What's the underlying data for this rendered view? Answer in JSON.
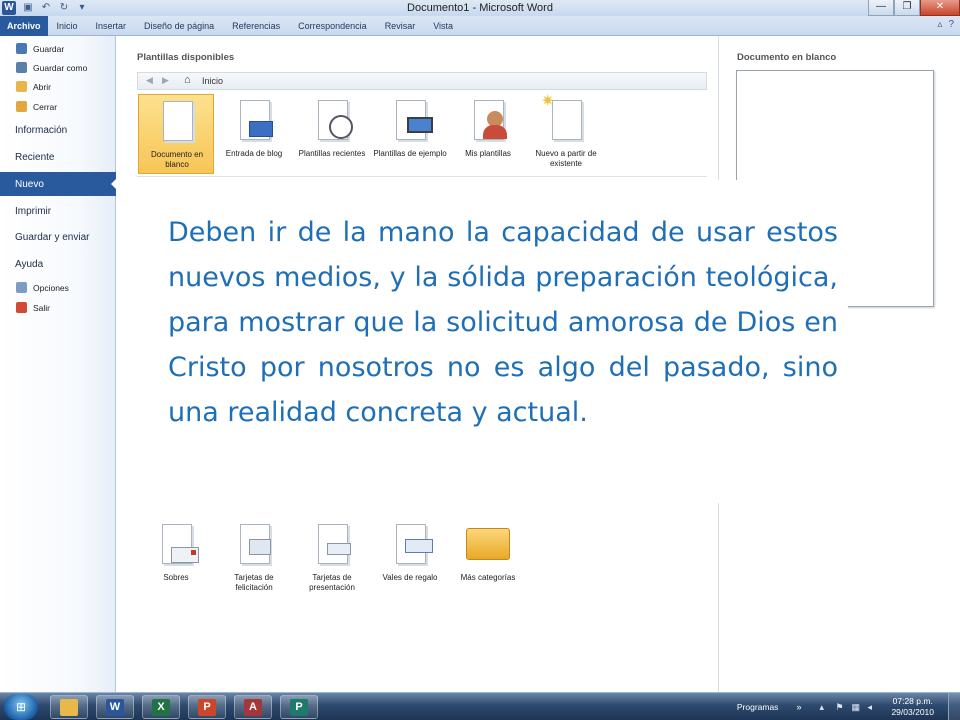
{
  "window": {
    "title": "Documento1 - Microsoft Word",
    "controls": [
      "—",
      "❐",
      "✕"
    ]
  },
  "ribbon": {
    "tabs": [
      "Archivo",
      "Inicio",
      "Insertar",
      "Diseño de página",
      "Referencias",
      "Correspondencia",
      "Revisar",
      "Vista"
    ]
  },
  "sidenav": {
    "save": "Guardar",
    "save_as": "Guardar como",
    "open": "Abrir",
    "close": "Cerrar",
    "info": "Información",
    "recent": "Reciente",
    "new": "Nuevo",
    "print": "Imprimir",
    "save_send": "Guardar y enviar",
    "help": "Ayuda",
    "options": "Opciones",
    "exit": "Salir"
  },
  "templates": {
    "section_title": "Plantillas disponibles",
    "breadcrumb": "Inicio",
    "row1": [
      {
        "label": "Documento en blanco",
        "icon": "blank-document-icon"
      },
      {
        "label": "Entrada de blog",
        "icon": "blog-post-icon"
      },
      {
        "label": "Plantillas recientes",
        "icon": "recent-templates-icon"
      },
      {
        "label": "Plantillas de ejemplo",
        "icon": "sample-templates-icon"
      },
      {
        "label": "Mis plantillas",
        "icon": "my-templates-icon"
      },
      {
        "label": "Nuevo a partir de existente",
        "icon": "new-from-existing-icon"
      }
    ],
    "row2": [
      {
        "label": "Sobres",
        "icon": "envelope-icon"
      },
      {
        "label": "Tarjetas de felicitación",
        "icon": "greeting-card-icon"
      },
      {
        "label": "Tarjetas de presentación",
        "icon": "business-card-icon"
      },
      {
        "label": "Vales de regalo",
        "icon": "gift-voucher-icon"
      },
      {
        "label": "Más categorías",
        "icon": "folder-icon"
      }
    ]
  },
  "preview": {
    "title": "Documento en blanco"
  },
  "callout": {
    "text": "Deben ir de la mano la capacidad de usar estos nuevos medios, y la sólida preparación teológica, para mostrar que la solicitud amorosa de Dios en Cristo por nosotros no es algo del pasado, sino una realidad concreta y actual."
  },
  "taskbar": {
    "programs_label": "Programas",
    "time": "07:28 p.m.",
    "date": "29/03/2010",
    "apps": [
      "Explorer",
      "Word",
      "Excel",
      "PowerPoint",
      "Access",
      "Publisher"
    ]
  },
  "colors": {
    "accent": "#2a5a9e",
    "callout_text": "#1f6fb7",
    "selected_template": "#f7c556"
  }
}
